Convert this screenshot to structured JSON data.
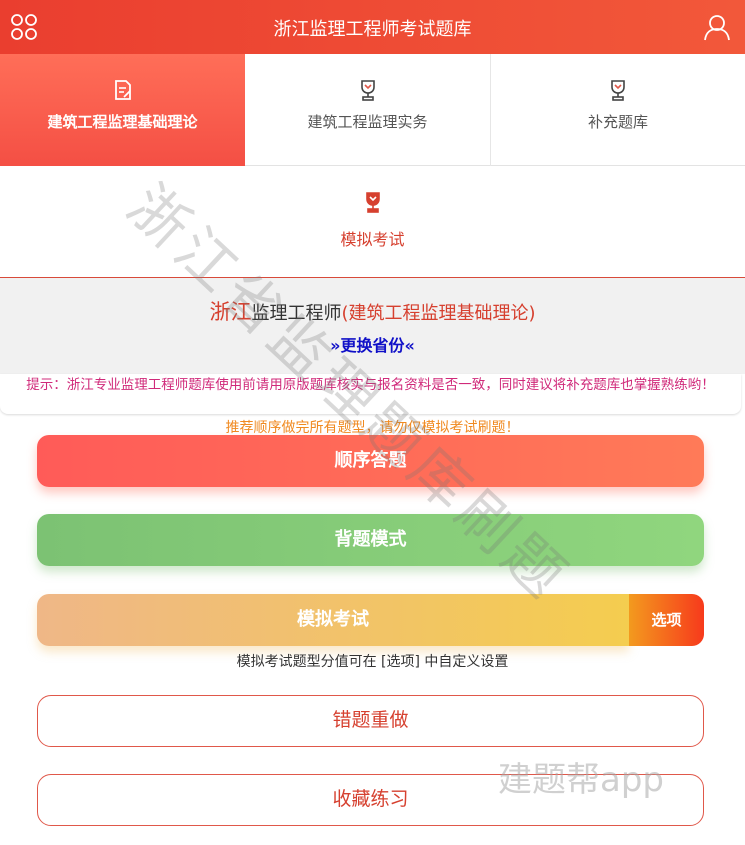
{
  "header": {
    "title": "浙江监理工程师考试题库",
    "menu_icon": "grid-icon",
    "user_icon": "user-icon"
  },
  "tabs": [
    {
      "label": "建筑工程监理基础理论",
      "icon": "document-edit-icon",
      "active": true
    },
    {
      "label": "建筑工程监理实务",
      "icon": "trophy-icon",
      "active": false
    },
    {
      "label": "补充题库",
      "icon": "trophy-icon",
      "active": false
    }
  ],
  "exam_tab": {
    "label": "模拟考试",
    "icon": "trophy-icon"
  },
  "info": {
    "province": "浙江",
    "role": "监理工程师",
    "subject": "(建筑工程监理基础理论)",
    "change_label": "»更换省份«"
  },
  "tip": "提示：浙江专业监理工程师题库使用前请用原版题库核实与报名资料是否一致，同时建议将补充题库也掌握熟练哟！",
  "recommend": "推荐顺序做完所有题型，请勿仅模拟考试刷题！",
  "buttons": {
    "sequential": "顺序答题",
    "memorize": "背题模式",
    "mock": "模拟考试",
    "options": "选项",
    "wrong_redo": "错题重做",
    "favorites": "收藏练习"
  },
  "mock_note": "模拟考试题型分值可在 [选项] 中自定义设置",
  "watermark": "浙江省监理题库刷题",
  "brand_watermark": "建题帮app",
  "colors": {
    "primary": "#ea3e2f",
    "active_tab": "#f44f44",
    "sequential": "#ff6458",
    "memorize": "#84cc78",
    "mock": "#f2c069",
    "options": "#f55a1e",
    "tip": "#d02a7a",
    "recommend": "#f08a20",
    "change_link": "#1010c8"
  }
}
